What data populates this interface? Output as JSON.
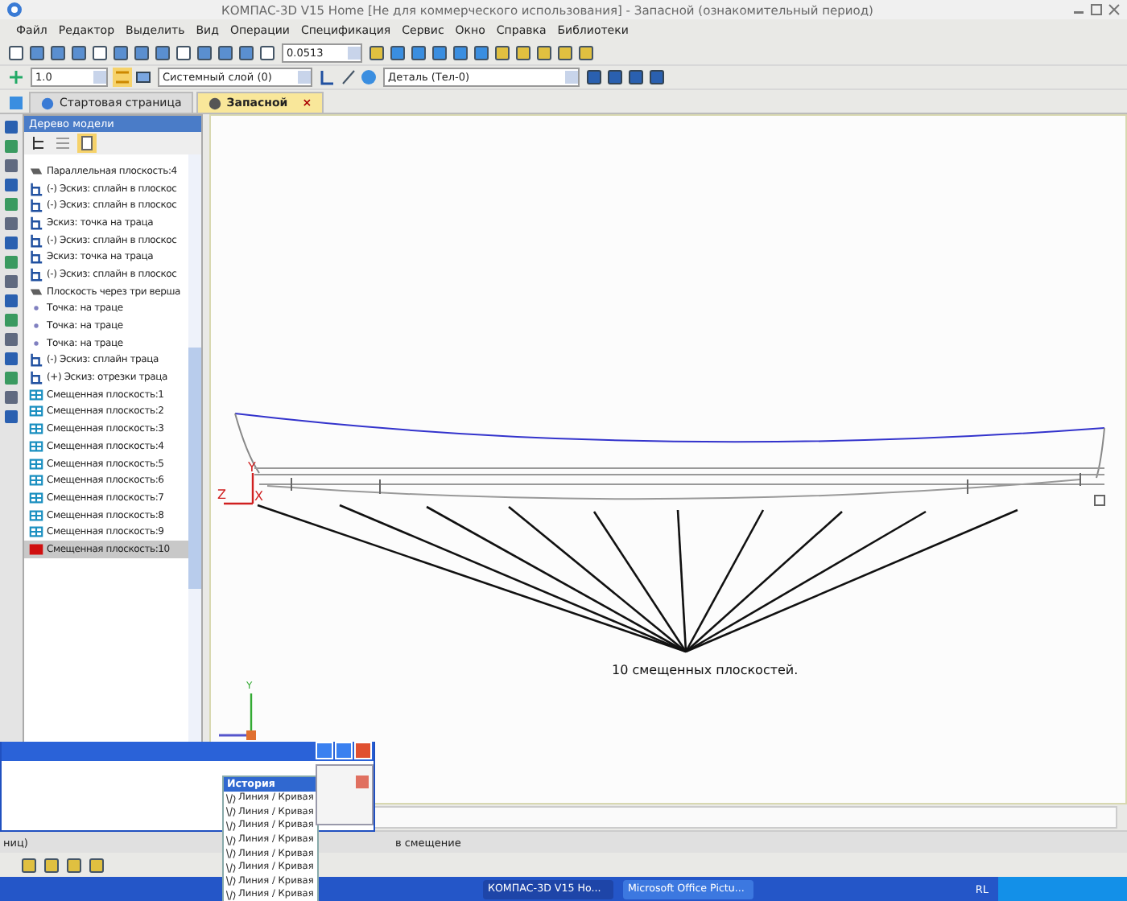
{
  "window": {
    "title": "КОМПАС-3D V15 Home [Не для коммерческого использования] - Запасной (ознакомительный период)"
  },
  "menu": [
    "Файл",
    "Редактор",
    "Выделить",
    "Вид",
    "Операции",
    "Спецификация",
    "Сервис",
    "Окно",
    "Справка",
    "Библиотеки"
  ],
  "toolbar": {
    "zoom_value": "0.0513",
    "line_scale": "1.0",
    "layer": "Системный слой (0)",
    "body": "Деталь (Тел-0)"
  },
  "tabs": [
    {
      "label": "Стартовая страница",
      "selected": false
    },
    {
      "label": "Запасной",
      "selected": true,
      "close": "×"
    }
  ],
  "tree": {
    "title": "Дерево модели",
    "items": [
      {
        "kind": "plane",
        "label": "Параллельная плоскость:4",
        "selected": false
      },
      {
        "kind": "sketch",
        "label": "(-) Эскиз: сплайн в плоскос",
        "selected": false
      },
      {
        "kind": "sketch",
        "label": "(-) Эскиз: сплайн в плоскос",
        "selected": false
      },
      {
        "kind": "sketch",
        "label": "Эскиз: точка на траца",
        "selected": false
      },
      {
        "kind": "sketch",
        "label": "(-) Эскиз: сплайн в плоскос",
        "selected": false
      },
      {
        "kind": "sketch",
        "label": "Эскиз: точка на траца",
        "selected": false
      },
      {
        "kind": "sketch",
        "label": "(-) Эскиз: сплайн в плоскос",
        "selected": false
      },
      {
        "kind": "plane",
        "label": "Плоскость через три верша",
        "selected": false
      },
      {
        "kind": "point",
        "label": "Точка: на траце",
        "selected": false
      },
      {
        "kind": "point",
        "label": "Точка: на траце",
        "selected": false
      },
      {
        "kind": "point",
        "label": "Точка: на траце",
        "selected": false
      },
      {
        "kind": "sketch",
        "label": "(-) Эскиз: сплайн траца",
        "selected": false
      },
      {
        "kind": "sketch",
        "label": "(+) Эскиз: отрезки траца",
        "selected": false
      },
      {
        "kind": "offset",
        "label": "Смещенная плоскость:1",
        "selected": false
      },
      {
        "kind": "offset",
        "label": "Смещенная плоскость:2",
        "selected": false
      },
      {
        "kind": "offset",
        "label": "Смещенная плоскость:3",
        "selected": false
      },
      {
        "kind": "offset",
        "label": "Смещенная плоскость:4",
        "selected": false
      },
      {
        "kind": "offset",
        "label": "Смещенная плоскость:5",
        "selected": false
      },
      {
        "kind": "offset",
        "label": "Смещенная плоскость:6",
        "selected": false
      },
      {
        "kind": "offset",
        "label": "Смещенная плоскость:7",
        "selected": false
      },
      {
        "kind": "offset",
        "label": "Смещенная плоскость:8",
        "selected": false
      },
      {
        "kind": "offset",
        "label": "Смещенная плоскость:9",
        "selected": false
      },
      {
        "kind": "offset",
        "label": "Смещенная плоскость:10",
        "selected": true
      }
    ]
  },
  "canvas": {
    "axis_y": "Y",
    "axis_z": "Z",
    "axis_x": "X",
    "triad_y": "Y",
    "annotation": "10 смещенных плоскостей."
  },
  "history": {
    "title": "История",
    "items": [
      "Линия / Кривая",
      "Линия / Кривая",
      "Линия / Кривая",
      "Линия / Кривая",
      "Линия / Кривая",
      "Линия / Кривая",
      "Линия / Кривая",
      "Линия / Кривая"
    ]
  },
  "status_bar": {
    "left": "ниц)",
    "right": "в смещение"
  },
  "taskbar": {
    "tasks": [
      {
        "label": "КОМПАС-3D V15 Ho...",
        "selected": true
      },
      {
        "label": "Microsoft Office Pictu...",
        "selected": false
      }
    ],
    "language": "RL"
  }
}
